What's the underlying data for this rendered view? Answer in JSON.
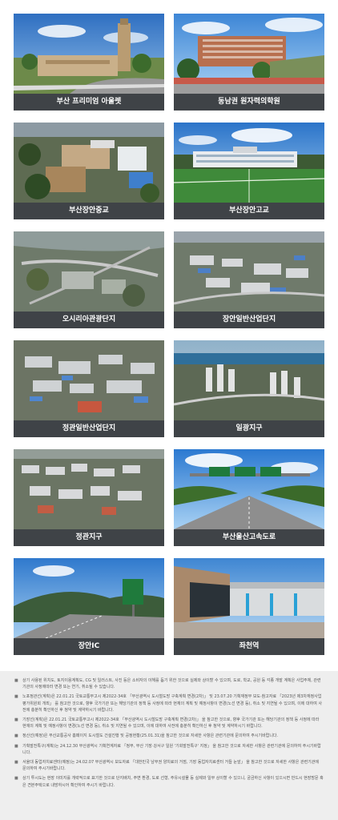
{
  "gallery": [
    {
      "caption": "부산 프리미엄 아울렛"
    },
    {
      "caption": "동남권 원자력의학원"
    },
    {
      "caption": "부산장안중교"
    },
    {
      "caption": "부산장안고교"
    },
    {
      "caption": "오시리아관광단지"
    },
    {
      "caption": "장안일반산업단지"
    },
    {
      "caption": "정관일반산업단지"
    },
    {
      "caption": "일광지구"
    },
    {
      "caption": "정관지구"
    },
    {
      "caption": "부산울산고속도로"
    },
    {
      "caption": "장안IC"
    },
    {
      "caption": "좌천역"
    }
  ],
  "notes": [
    "상기 사용된 위치도, 토지이용계획도, CG 및 일러스트, 사진 등은 소비자의 이해를 돕기 위한 것으로 실제와 상이할 수 있으며, 도로, 학교, 공원 등 각종 개발 계획은 사업주체, 관련 기관의 사정에따라 변경 또는 연기, 취소될 수 있습니다.",
    "노포정관선(계획)은 22.01.21 국토교통부고시 제2022-34호 「부산광역시 도시철도망 구축계획 변경(2차)」 및 23.07.20 기획재정부 보도·참고자료 「2023년 제3차재정사업평가위원회 개최」 를 참고한 것으로, 향후 국가기관 또는 해당기관의 정책 등 사정에 따라 현재의 계획 및 예정사항이 변경(노선 변경 등), 취소 및 지연될 수 있으며, 이에 대하여 사전에 충분히 확인하신 후 청약 및 계약하시기 바랍니다.",
    "기장선(계획)은 22.01.21 국토교통부고시 제2022-34호 「부산광역시 도시철도망 구축계획 변경(2차)」 을 참고한 것으로, 향후 국가기관 또는 해당기관의 정책 등 사정에 따라 현재의 계획 및 예정사항이 변경(노선 변경 등), 취소 및 지연될 수 있으며, 이에 대하여 사전에 충분히 확인하신 후 청약 및 계약하시기 바랍니다.",
    "정산선(예정)은 부산교통공사 홈페이지 도시철도 건설진행 및 공정현황(25.01.31)을 참고한 것으로 자세한 사항은 관련기관에 문의하여 주시기바랍니다.",
    "기획발전특구(계획)는 24.12.30 부산광역시 기획연계자료 「정부, 부산 기장·강서구 일원 '기회발전특구' 지정」 을 참고한 것으로 자세한 사항은 관련기관에 문의하여 주시기바랍니다.",
    "서울대 동업자치료센터(예정)는 24.02.07 부산광역시 보도자료 「대한민국 남부권 양치료의 거점, 기장 동업자치료센터 거듭 눈앞」 을 참고한 것으로 자세한 사항은 관련기관에 문의하여 주시기바랍니다.",
    "상기 투시도는 현장 이미지를 개략적으로 표기한 것으로 단지배치, 주변 환경, 도로 선형, 주유시설물 등 실제와 일부 상이할 수 있으니, 궁금하신 사항이 있으시면 반드시 현장방문 혹은 견본주택으로 내방하시어 확인하여 주시기 바랍니다."
  ],
  "colors": {
    "caption_bg": "#3f4347",
    "caption_text": "#ffffff",
    "notes_bg": "#eeeeee"
  }
}
